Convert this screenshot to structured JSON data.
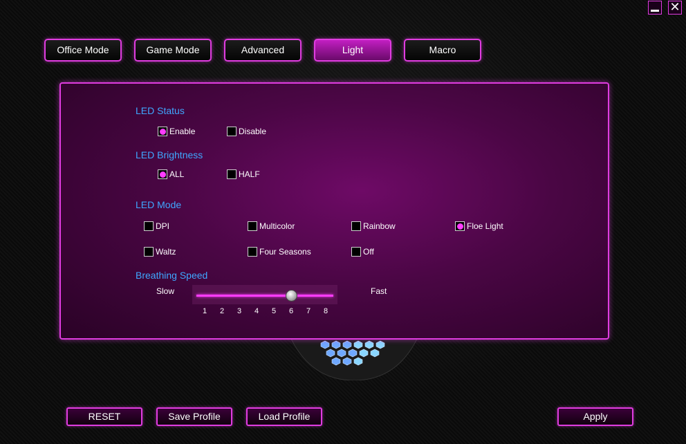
{
  "window": {
    "minimize_icon": "minimize-icon",
    "close_icon": "close-icon"
  },
  "tabs": [
    {
      "label": "Office Mode",
      "active": false
    },
    {
      "label": "Game Mode",
      "active": false
    },
    {
      "label": "Advanced",
      "active": false
    },
    {
      "label": "Light",
      "active": true
    },
    {
      "label": "Macro",
      "active": false
    }
  ],
  "led_status": {
    "title": "LED Status",
    "options": [
      {
        "label": "Enable",
        "selected": true
      },
      {
        "label": "Disable",
        "selected": false
      }
    ]
  },
  "led_brightness": {
    "title": "LED Brightness",
    "options": [
      {
        "label": "ALL",
        "selected": true
      },
      {
        "label": "HALF",
        "selected": false
      }
    ]
  },
  "led_mode": {
    "title": "LED Mode",
    "options": [
      {
        "label": "DPI",
        "selected": false
      },
      {
        "label": "Multicolor",
        "selected": false
      },
      {
        "label": "Rainbow",
        "selected": false
      },
      {
        "label": "Floe Light",
        "selected": true
      },
      {
        "label": "Waltz",
        "selected": false
      },
      {
        "label": "Four Seasons",
        "selected": false
      },
      {
        "label": "Off",
        "selected": false
      }
    ]
  },
  "breathing_speed": {
    "title": "Breathing Speed",
    "slow_label": "Slow",
    "fast_label": "Fast",
    "ticks": [
      "1",
      "2",
      "3",
      "4",
      "5",
      "6",
      "7",
      "8"
    ],
    "value": 6
  },
  "buttons": {
    "reset": "RESET",
    "save_profile": "Save Profile",
    "load_profile": "Load Profile",
    "apply": "Apply"
  },
  "colors": {
    "accent": "#e03ce0",
    "title_blue": "#3fa7ff",
    "selected_dot": "#ff3cff"
  }
}
